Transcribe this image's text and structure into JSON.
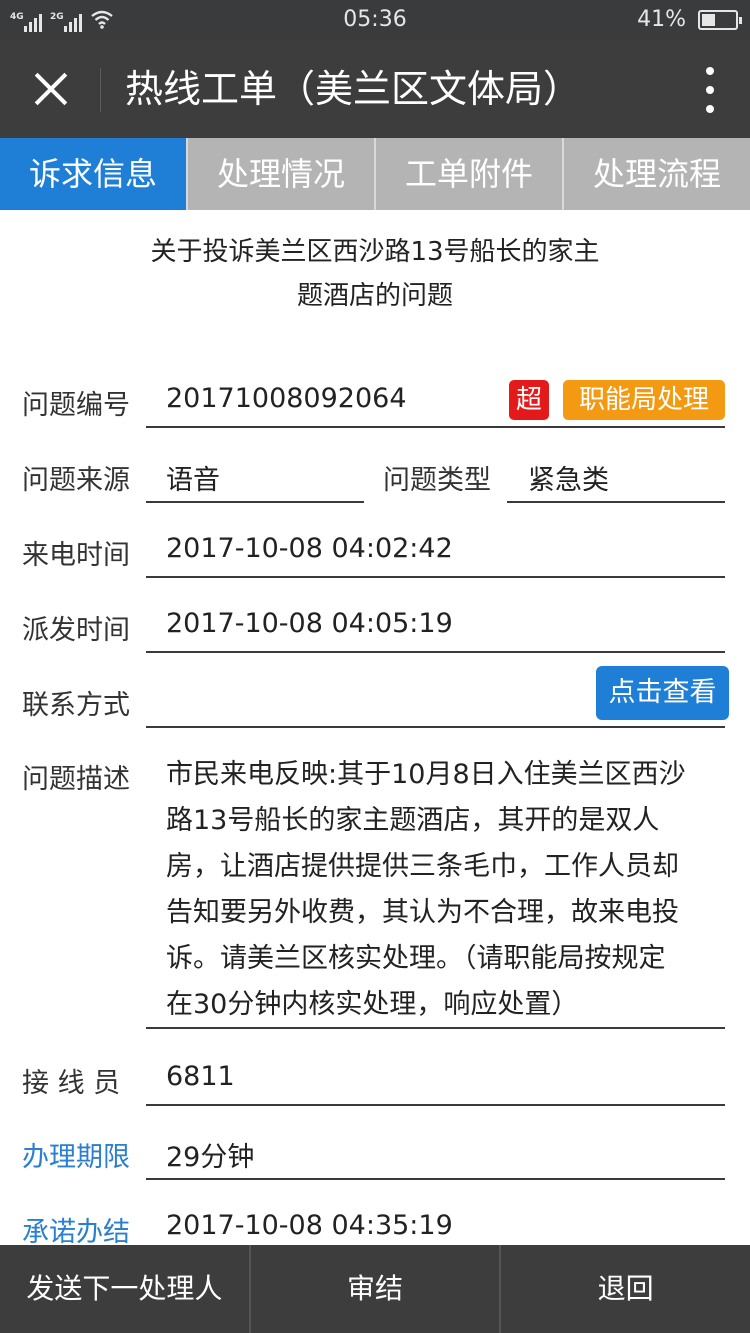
{
  "status_bar": {
    "net1": "4G",
    "net2": "2G",
    "time": "05:36",
    "battery_percent": "41%",
    "battery_level": 0.41
  },
  "title_bar": {
    "title": "热线工单（美兰区文体局）"
  },
  "tabs": [
    {
      "label": "诉求信息",
      "active": true
    },
    {
      "label": "处理情况",
      "active": false
    },
    {
      "label": "工单附件",
      "active": false
    },
    {
      "label": "处理流程",
      "active": false
    }
  ],
  "subject": {
    "line1": "关于投诉美兰区西沙路13号船长的家主",
    "line2": "题酒店的问题"
  },
  "fields": {
    "issue_no_label": "问题编号",
    "issue_no": "20171008092064",
    "overdue_badge": "超",
    "dept_badge": "职能局处理",
    "source_label": "问题来源",
    "source": "语音",
    "type_label": "问题类型",
    "type": "紧急类",
    "call_time_label": "来电时间",
    "call_time": "2017-10-08 04:02:42",
    "dispatch_time_label": "派发时间",
    "dispatch_time": "2017-10-08 04:05:19",
    "contact_label": "联系方式",
    "contact_button": "点击查看",
    "desc_label": "问题描述",
    "desc_lines": [
      "市民来电反映:其于10月8日入住美兰区西沙",
      "路13号船长的家主题酒店，其开的是双人",
      "房，让酒店提供提供三条毛巾，工作人员却",
      "告知要另外收费，其认为不合理，故来电投",
      "诉。请美兰区核实处理。（请职能局按规定",
      "在30分钟内核实处理，响应处置）"
    ],
    "operator_label": "接 线 员",
    "operator": "6811",
    "deadline_label": "办理期限",
    "deadline": "29分钟",
    "promise_label": "承诺办结",
    "promise_time": "2017-10-08 04:35:19"
  },
  "bottom_bar": {
    "send_next": "发送下一处理人",
    "close_case": "审结",
    "return": "退回"
  },
  "colors": {
    "accent_blue": "#1f7fd6",
    "overdue_red": "#e41a1a",
    "dept_orange": "#f39a12",
    "bar_dark": "#3d3d3e"
  }
}
